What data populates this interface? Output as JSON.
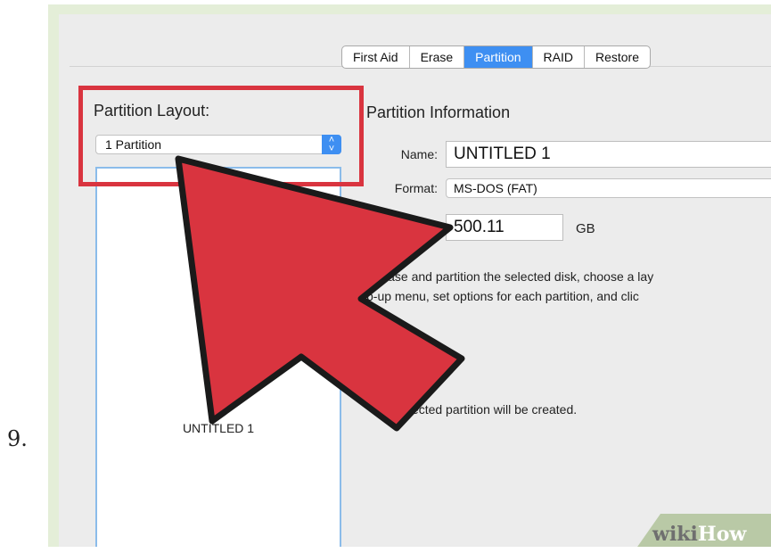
{
  "step_number": "9.",
  "tabs": [
    {
      "label": "First Aid",
      "active": false
    },
    {
      "label": "Erase",
      "active": false
    },
    {
      "label": "Partition",
      "active": true
    },
    {
      "label": "RAID",
      "active": false
    },
    {
      "label": "Restore",
      "active": false
    }
  ],
  "partition_layout": {
    "title": "Partition Layout:",
    "selected_option": "1 Partition",
    "disk_partition_label": "UNTITLED 1"
  },
  "partition_info": {
    "title": "Partition Information",
    "name_label": "Name:",
    "name_value": "UNTITLED 1",
    "format_label": "Format:",
    "format_value": "MS-DOS (FAT)",
    "size_value": "500.11",
    "size_unit": "GB",
    "description_line1": "o erase and partition the selected disk, choose a lay",
    "description_line2": "p-up menu, set options for each partition, and clic",
    "status_text": "The selected partition will be created."
  },
  "watermark": {
    "part1": "wiki",
    "part2": "How"
  },
  "colors": {
    "highlight": "#d9343f",
    "arrow": "#d9343f",
    "accent": "#3e8ff2",
    "frame": "#e4eed8"
  }
}
